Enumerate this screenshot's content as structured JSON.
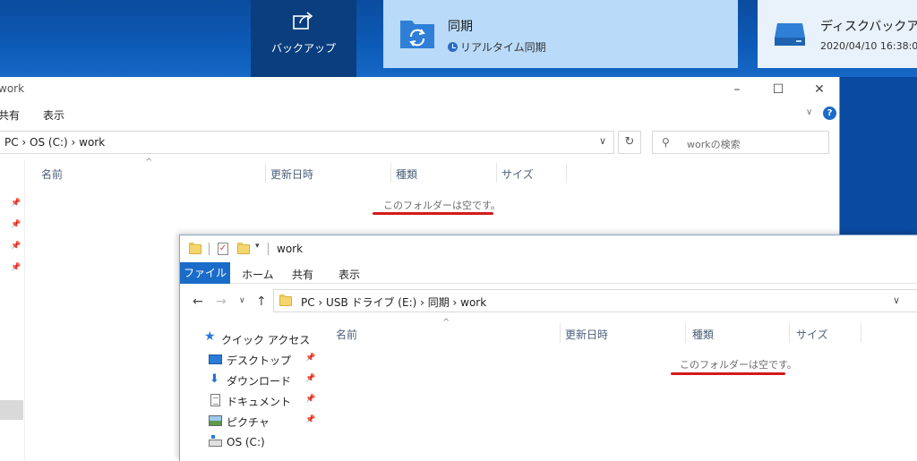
{
  "topbar": {
    "backup_label": "バックアップ",
    "sync_card": {
      "title": "同期",
      "subtitle": "リアルタイム同期"
    },
    "disk_card": {
      "title": "ディスクバックアップ",
      "timestamp": "2020/04/10 16:38:0"
    }
  },
  "back_window": {
    "title": "work",
    "menu": [
      "共有",
      "表示"
    ],
    "address": "PC  ›  OS (C:)  ›  work",
    "search_placeholder": "workの検索",
    "columns": [
      "名前",
      "更新日時",
      "種類",
      "サイズ"
    ],
    "empty_message": "このフォルダーは空です。"
  },
  "front_window": {
    "title": "work",
    "ribbon_tabs": [
      "ファイル",
      "ホーム",
      "共有",
      "表示"
    ],
    "address": "PC  ›  USB ドライブ (E:)  ›  同期  ›  work",
    "columns": [
      "名前",
      "更新日時",
      "種類",
      "サイズ"
    ],
    "empty_message": "このフォルダーは空です。",
    "sidebar": [
      {
        "label": "クイック アクセス"
      },
      {
        "label": "デスクトップ"
      },
      {
        "label": "ダウンロード"
      },
      {
        "label": "ドキュメント"
      },
      {
        "label": "ピクチャ"
      },
      {
        "label": "OS (C:)"
      }
    ]
  },
  "colors": {
    "accent": "#1a6cc8",
    "highlight_underline": "#d21a1a",
    "sync_card_bg": "#b9daf8",
    "taskbar": "#0b4c9e"
  }
}
